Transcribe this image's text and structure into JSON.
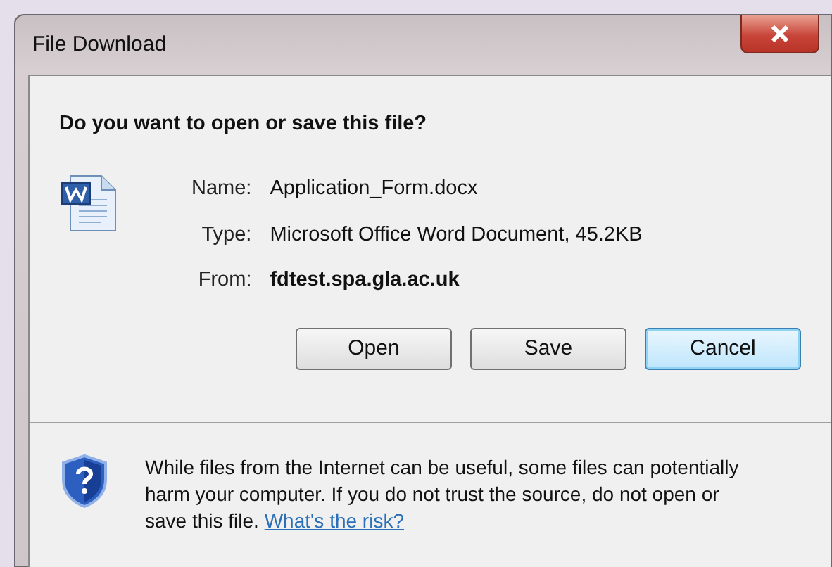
{
  "window": {
    "title": "File Download"
  },
  "question": "Do you want to open or save this file?",
  "fields": [
    {
      "label": "Name:",
      "value": "Application_Form.docx",
      "bold": false
    },
    {
      "label": "Type:",
      "value": "Microsoft Office Word Document, 45.2KB",
      "bold": false
    },
    {
      "label": "From:",
      "value": "fdtest.spa.gla.ac.uk",
      "bold": true
    }
  ],
  "buttons": [
    {
      "label": "Open",
      "default": false
    },
    {
      "label": "Save",
      "default": false
    },
    {
      "label": "Cancel",
      "default": true
    }
  ],
  "warning": {
    "text": "While files from the Internet can be useful, some files can potentially harm your computer. If you do not trust the source, do not open or save this file.",
    "link": "What's the risk?"
  }
}
